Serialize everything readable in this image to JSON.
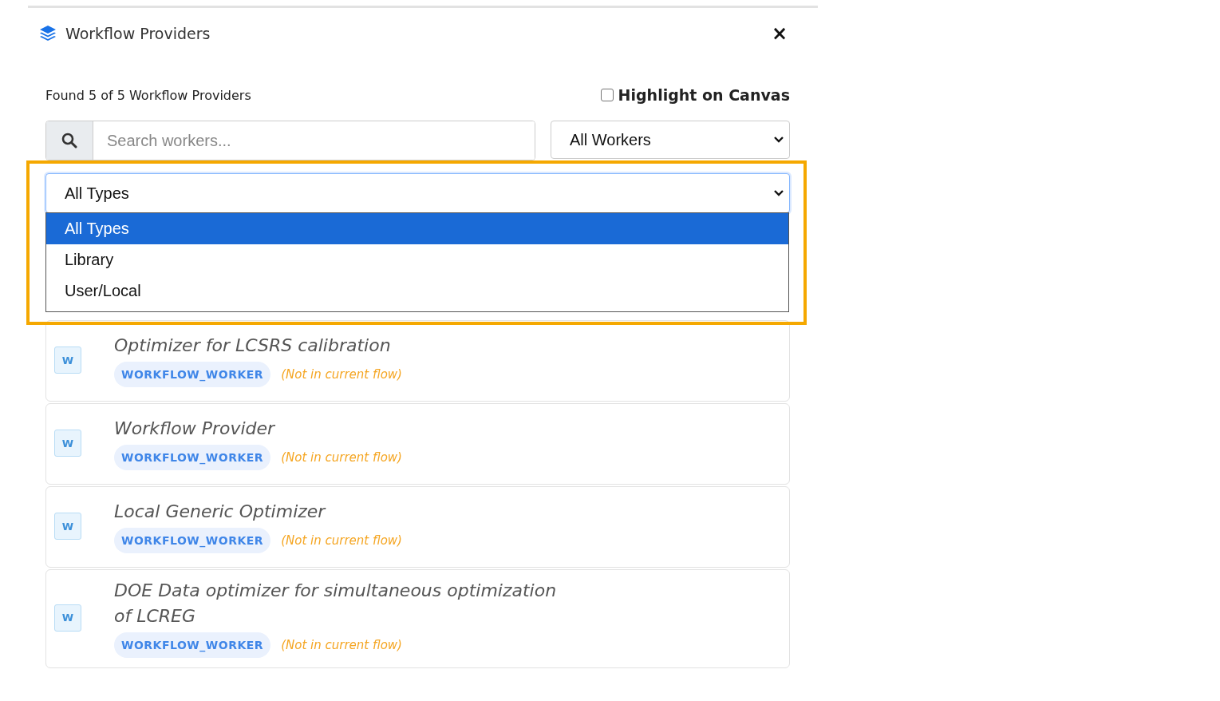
{
  "panel": {
    "title": "Workflow Providers",
    "close": "×"
  },
  "summary": "Found 5 of 5 Workflow Providers",
  "highlight": {
    "label": "Highlight on Canvas",
    "checked": false
  },
  "search": {
    "placeholder": "Search workers..."
  },
  "worker_filter": {
    "value": "All Workers"
  },
  "type_filter": {
    "value": "All Types",
    "expanded": true,
    "annotated": true,
    "options": [
      {
        "label": "All Types",
        "selected": true
      },
      {
        "label": "Library",
        "selected": false
      },
      {
        "label": "User/Local",
        "selected": false
      }
    ]
  },
  "providers": [
    {
      "icon_letter": "W",
      "name": "Optimizer for LCSRS calibration",
      "type": "WORKFLOW_WORKER",
      "status": "(Not in current flow)"
    },
    {
      "icon_letter": "W",
      "name": "Workflow Provider",
      "type": "WORKFLOW_WORKER",
      "status": "(Not in current flow)"
    },
    {
      "icon_letter": "W",
      "name": "Local Generic Optimizer",
      "type": "WORKFLOW_WORKER",
      "status": "(Not in current flow)"
    },
    {
      "icon_letter": "W",
      "name": "DOE Data optimizer for simultaneous optimization of LCREG",
      "type": "WORKFLOW_WORKER",
      "status": "(Not in current flow)"
    }
  ]
}
